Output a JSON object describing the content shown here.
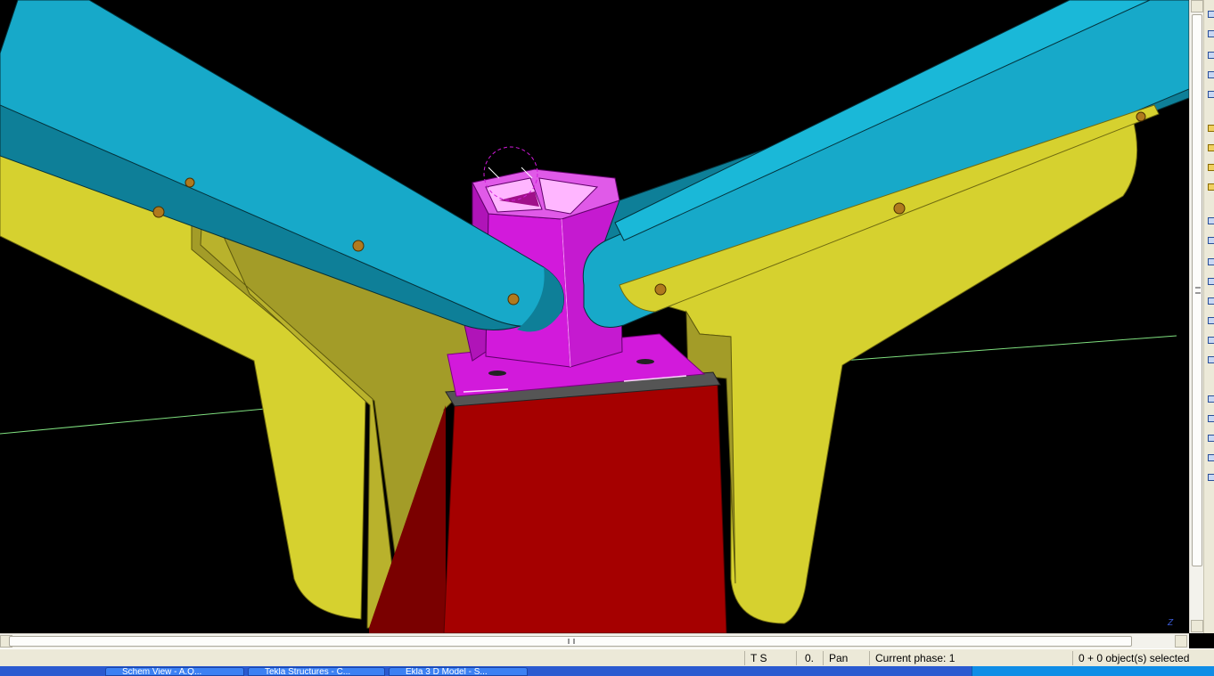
{
  "viewport": {
    "background": "#000000",
    "colors": {
      "tube": "#17a9c9",
      "tube_dark": "#0e7f98",
      "gusset": "#d6d12f",
      "gusset_dark": "#a39c28",
      "pedestal": "#d21adb",
      "column": "#a50000",
      "column_dark": "#7a0000",
      "bolt": "#b07a1e",
      "grid_line": "#7fe07f"
    }
  },
  "scrollbars": {
    "horizontal_grip": "III",
    "axis_mark": "Z"
  },
  "statusbar": {
    "cells": [
      {
        "id": "ts",
        "label": "T S"
      },
      {
        "id": "zero",
        "label": "0."
      },
      {
        "id": "mode",
        "label": "Pan"
      },
      {
        "id": "phase",
        "label": "Current phase: 1"
      },
      {
        "id": "selection",
        "label": "0 + 0 object(s) selected"
      }
    ]
  },
  "taskbar": {
    "items": [
      {
        "label": "Schem View - A.Q..."
      },
      {
        "label": "Tekla Structures - C..."
      },
      {
        "label": "Ekla 3 D Model - S..."
      }
    ]
  }
}
